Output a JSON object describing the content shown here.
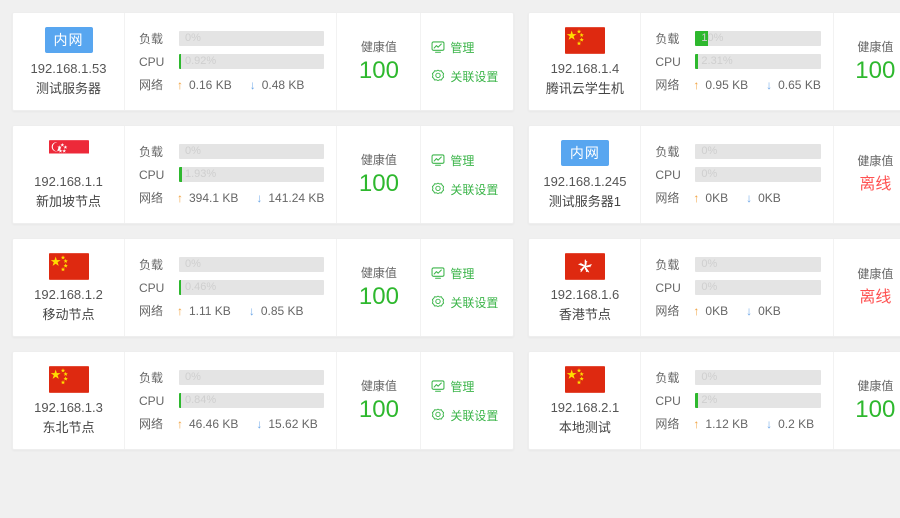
{
  "labels": {
    "load": "负载",
    "cpu": "CPU",
    "network": "网络",
    "health": "健康值",
    "manage": "管理",
    "settings": "关联设置",
    "intranet_badge": "内网",
    "offline": "离线",
    "up_arrow": "↑",
    "down_arrow": "↓"
  },
  "colors": {
    "page_bg": "#f0f0f0",
    "card_bg": "#ffffff",
    "accent_green": "#3cb54a",
    "health_green": "#2eb82e",
    "offline_red": "#ff5252",
    "badge_blue": "#58a6f0",
    "bar_track": "#e4e4e4",
    "upload_orange": "#f0a03c",
    "download_blue": "#6fa8e8"
  },
  "icons": {
    "manage": "monitor-chart-icon",
    "settings": "gear-icon",
    "upload": "arrow-up-icon",
    "download": "arrow-down-icon"
  },
  "servers": [
    {
      "ip": "192.168.1.53",
      "name": "测试服务器",
      "region_type": "intranet",
      "region_badge": "内网",
      "flag": "",
      "load_text": "0%",
      "load_pct": 0,
      "cpu_text": "0.92%",
      "cpu_pct": 1.5,
      "net_up": "0.16 KB",
      "net_down": "0.48 KB",
      "health_label": "健康值",
      "health_value": "100",
      "online": true
    },
    {
      "ip": "192.168.1.4",
      "name": "腾讯云学生机",
      "region_type": "flag",
      "region_badge": "",
      "flag": "cn",
      "load_text": "10%",
      "load_pct": 10,
      "cpu_text": "2.31%",
      "cpu_pct": 2.3,
      "net_up": "0.95 KB",
      "net_down": "0.65 KB",
      "health_label": "健康值",
      "health_value": "100",
      "online": true
    },
    {
      "ip": "192.168.1.1",
      "name": "新加坡节点",
      "region_type": "flag",
      "region_badge": "",
      "flag": "sg",
      "load_text": "0%",
      "load_pct": 0,
      "cpu_text": "1.93%",
      "cpu_pct": 2,
      "net_up": "394.1 KB",
      "net_down": "141.24 KB",
      "health_label": "健康值",
      "health_value": "100",
      "online": true
    },
    {
      "ip": "192.168.1.245",
      "name": "测试服务器1",
      "region_type": "intranet",
      "region_badge": "内网",
      "flag": "",
      "load_text": "0%",
      "load_pct": 0,
      "cpu_text": "0%",
      "cpu_pct": 0,
      "net_up": "0KB",
      "net_down": "0KB",
      "health_label": "健康值",
      "health_value": "离线",
      "online": false
    },
    {
      "ip": "192.168.1.2",
      "name": "移动节点",
      "region_type": "flag",
      "region_badge": "",
      "flag": "cn",
      "load_text": "0%",
      "load_pct": 0,
      "cpu_text": "0.46%",
      "cpu_pct": 1.5,
      "net_up": "1.11 KB",
      "net_down": "0.85 KB",
      "health_label": "健康值",
      "health_value": "100",
      "online": true
    },
    {
      "ip": "192.168.1.6",
      "name": "香港节点",
      "region_type": "flag",
      "region_badge": "",
      "flag": "hk",
      "load_text": "0%",
      "load_pct": 0,
      "cpu_text": "0%",
      "cpu_pct": 0,
      "net_up": "0KB",
      "net_down": "0KB",
      "health_label": "健康值",
      "health_value": "离线",
      "online": false
    },
    {
      "ip": "192.168.1.3",
      "name": "东北节点",
      "region_type": "flag",
      "region_badge": "",
      "flag": "cn",
      "load_text": "0%",
      "load_pct": 0,
      "cpu_text": "0.84%",
      "cpu_pct": 1.5,
      "net_up": "46.46 KB",
      "net_down": "15.62 KB",
      "health_label": "健康值",
      "health_value": "100",
      "online": true
    },
    {
      "ip": "192.168.2.1",
      "name": "本地测试",
      "region_type": "flag",
      "region_badge": "",
      "flag": "cn",
      "load_text": "0%",
      "load_pct": 0,
      "cpu_text": "2%",
      "cpu_pct": 2,
      "net_up": "1.12 KB",
      "net_down": "0.2 KB",
      "health_label": "健康值",
      "health_value": "100",
      "online": true
    }
  ]
}
